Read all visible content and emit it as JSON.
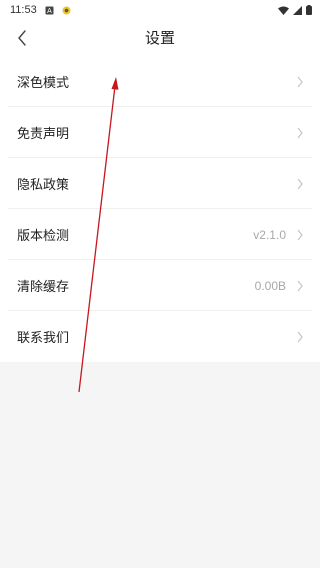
{
  "status_bar": {
    "time": "11:53",
    "icons": [
      "notification-a-icon",
      "notification-dot-icon",
      "wifi-icon",
      "signal-icon",
      "battery-icon"
    ]
  },
  "header": {
    "title": "设置",
    "back_icon": "chevron-left-icon"
  },
  "settings": [
    {
      "label": "深色模式",
      "value": ""
    },
    {
      "label": "免责声明",
      "value": ""
    },
    {
      "label": "隐私政策",
      "value": ""
    },
    {
      "label": "版本检测",
      "value": "v2.1.0"
    },
    {
      "label": "清除缓存",
      "value": "0.00B"
    },
    {
      "label": "联系我们",
      "value": ""
    }
  ],
  "colors": {
    "background": "#f5f5f5",
    "surface": "#ffffff",
    "annotation_arrow": "#c8161d",
    "muted_text": "#a8a8a8"
  }
}
